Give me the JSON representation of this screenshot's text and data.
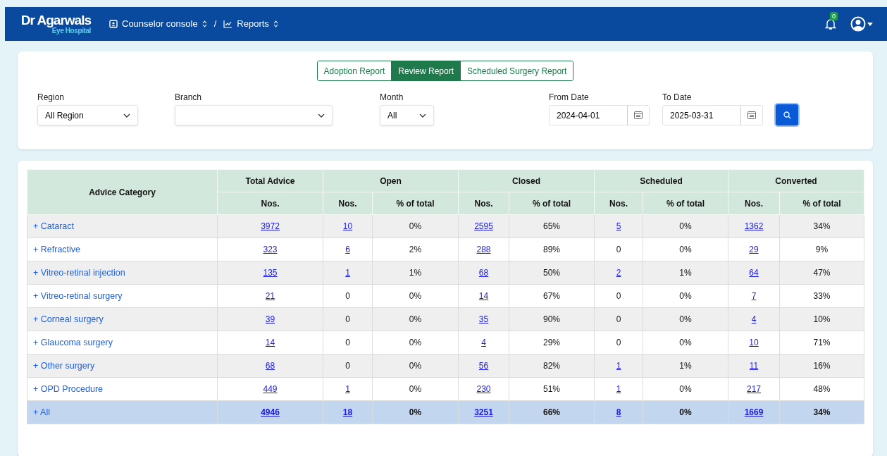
{
  "header": {
    "logo_title": "Dr Agarwals",
    "logo_subtitle": "Eye Hospital",
    "breadcrumbs": [
      {
        "label": "Counselor console"
      },
      {
        "label": "Reports"
      }
    ],
    "separator": "/",
    "notification_count": "0"
  },
  "tabs": [
    {
      "label": "Adoption Report",
      "selected": false
    },
    {
      "label": "Review Report",
      "selected": true
    },
    {
      "label": "Scheduled Surgery Report",
      "selected": false
    }
  ],
  "filters": [
    {
      "kind": "select",
      "label": "Region",
      "value": "All Region"
    },
    {
      "kind": "select",
      "label": "Branch"
    },
    {
      "kind": "select",
      "label": "Month",
      "value": "All"
    },
    {
      "kind": "date",
      "label": "From Date",
      "value": "2024-04-01"
    },
    {
      "kind": "date",
      "label": "To Date",
      "value": "2025-03-31"
    }
  ],
  "table": {
    "category_heading": "Advice Category",
    "groups": [
      {
        "label": "Total Advice",
        "columns": [
          "Nos."
        ]
      },
      {
        "label": "Open",
        "columns": [
          "Nos.",
          "% of total"
        ]
      },
      {
        "label": "Closed",
        "columns": [
          "Nos.",
          "% of total"
        ]
      },
      {
        "label": "Scheduled",
        "columns": [
          "Nos.",
          "% of total"
        ]
      },
      {
        "label": "Converted",
        "columns": [
          "Nos.",
          "% of total"
        ]
      }
    ],
    "rows": [
      {
        "kind": "item",
        "expander": "+",
        "category": "Cataract",
        "cells": [
          {
            "text": "3972",
            "link": true
          },
          {
            "text": "10",
            "link": true
          },
          {
            "text": "0%",
            "link": false
          },
          {
            "text": "2595",
            "link": true
          },
          {
            "text": "65%",
            "link": false
          },
          {
            "text": "5",
            "link": true
          },
          {
            "text": "0%",
            "link": false
          },
          {
            "text": "1362",
            "link": true
          },
          {
            "text": "34%",
            "link": false
          }
        ]
      },
      {
        "kind": "item",
        "expander": "+",
        "category": "Refractive",
        "cells": [
          {
            "text": "323",
            "link": true
          },
          {
            "text": "6",
            "link": true
          },
          {
            "text": "2%",
            "link": false
          },
          {
            "text": "288",
            "link": true
          },
          {
            "text": "89%",
            "link": false
          },
          {
            "text": "0",
            "link": false
          },
          {
            "text": "0%",
            "link": false
          },
          {
            "text": "29",
            "link": true
          },
          {
            "text": "9%",
            "link": false
          }
        ]
      },
      {
        "kind": "item",
        "expander": "+",
        "category": "Vitreo-retinal injection",
        "cells": [
          {
            "text": "135",
            "link": true
          },
          {
            "text": "1",
            "link": true
          },
          {
            "text": "1%",
            "link": false
          },
          {
            "text": "68",
            "link": true
          },
          {
            "text": "50%",
            "link": false
          },
          {
            "text": "2",
            "link": true
          },
          {
            "text": "1%",
            "link": false
          },
          {
            "text": "64",
            "link": true
          },
          {
            "text": "47%",
            "link": false
          }
        ]
      },
      {
        "kind": "item",
        "expander": "+",
        "category": "Vitreo-retinal surgery",
        "cells": [
          {
            "text": "21",
            "link": true
          },
          {
            "text": "0",
            "link": false
          },
          {
            "text": "0%",
            "link": false
          },
          {
            "text": "14",
            "link": true
          },
          {
            "text": "67%",
            "link": false
          },
          {
            "text": "0",
            "link": false
          },
          {
            "text": "0%",
            "link": false
          },
          {
            "text": "7",
            "link": true
          },
          {
            "text": "33%",
            "link": false
          }
        ]
      },
      {
        "kind": "item",
        "expander": "+",
        "category": "Corneal surgery",
        "cells": [
          {
            "text": "39",
            "link": true
          },
          {
            "text": "0",
            "link": false
          },
          {
            "text": "0%",
            "link": false
          },
          {
            "text": "35",
            "link": true
          },
          {
            "text": "90%",
            "link": false
          },
          {
            "text": "0",
            "link": false
          },
          {
            "text": "0%",
            "link": false
          },
          {
            "text": "4",
            "link": true
          },
          {
            "text": "10%",
            "link": false
          }
        ]
      },
      {
        "kind": "item",
        "expander": "+",
        "category": "Glaucoma surgery",
        "cells": [
          {
            "text": "14",
            "link": true
          },
          {
            "text": "0",
            "link": false
          },
          {
            "text": "0%",
            "link": false
          },
          {
            "text": "4",
            "link": true
          },
          {
            "text": "29%",
            "link": false
          },
          {
            "text": "0",
            "link": false
          },
          {
            "text": "0%",
            "link": false
          },
          {
            "text": "10",
            "link": true
          },
          {
            "text": "71%",
            "link": false
          }
        ]
      },
      {
        "kind": "item",
        "expander": "+",
        "category": "Other surgery",
        "cells": [
          {
            "text": "68",
            "link": true
          },
          {
            "text": "0",
            "link": false
          },
          {
            "text": "0%",
            "link": false
          },
          {
            "text": "56",
            "link": true
          },
          {
            "text": "82%",
            "link": false
          },
          {
            "text": "1",
            "link": true
          },
          {
            "text": "1%",
            "link": false
          },
          {
            "text": "11",
            "link": true
          },
          {
            "text": "16%",
            "link": false
          }
        ]
      },
      {
        "kind": "item",
        "expander": "+",
        "category": "OPD Procedure",
        "cells": [
          {
            "text": "449",
            "link": true
          },
          {
            "text": "1",
            "link": true
          },
          {
            "text": "0%",
            "link": false
          },
          {
            "text": "230",
            "link": true
          },
          {
            "text": "51%",
            "link": false
          },
          {
            "text": "1",
            "link": true
          },
          {
            "text": "0%",
            "link": false
          },
          {
            "text": "217",
            "link": true
          },
          {
            "text": "48%",
            "link": false
          }
        ]
      },
      {
        "kind": "total",
        "expander": "+",
        "category": "All",
        "cells": [
          {
            "text": "4946",
            "link": true
          },
          {
            "text": "18",
            "link": true
          },
          {
            "text": "0%",
            "link": false
          },
          {
            "text": "3251",
            "link": true
          },
          {
            "text": "66%",
            "link": false
          },
          {
            "text": "8",
            "link": true
          },
          {
            "text": "0%",
            "link": false
          },
          {
            "text": "1669",
            "link": true
          },
          {
            "text": "34%",
            "link": false
          }
        ]
      }
    ]
  }
}
